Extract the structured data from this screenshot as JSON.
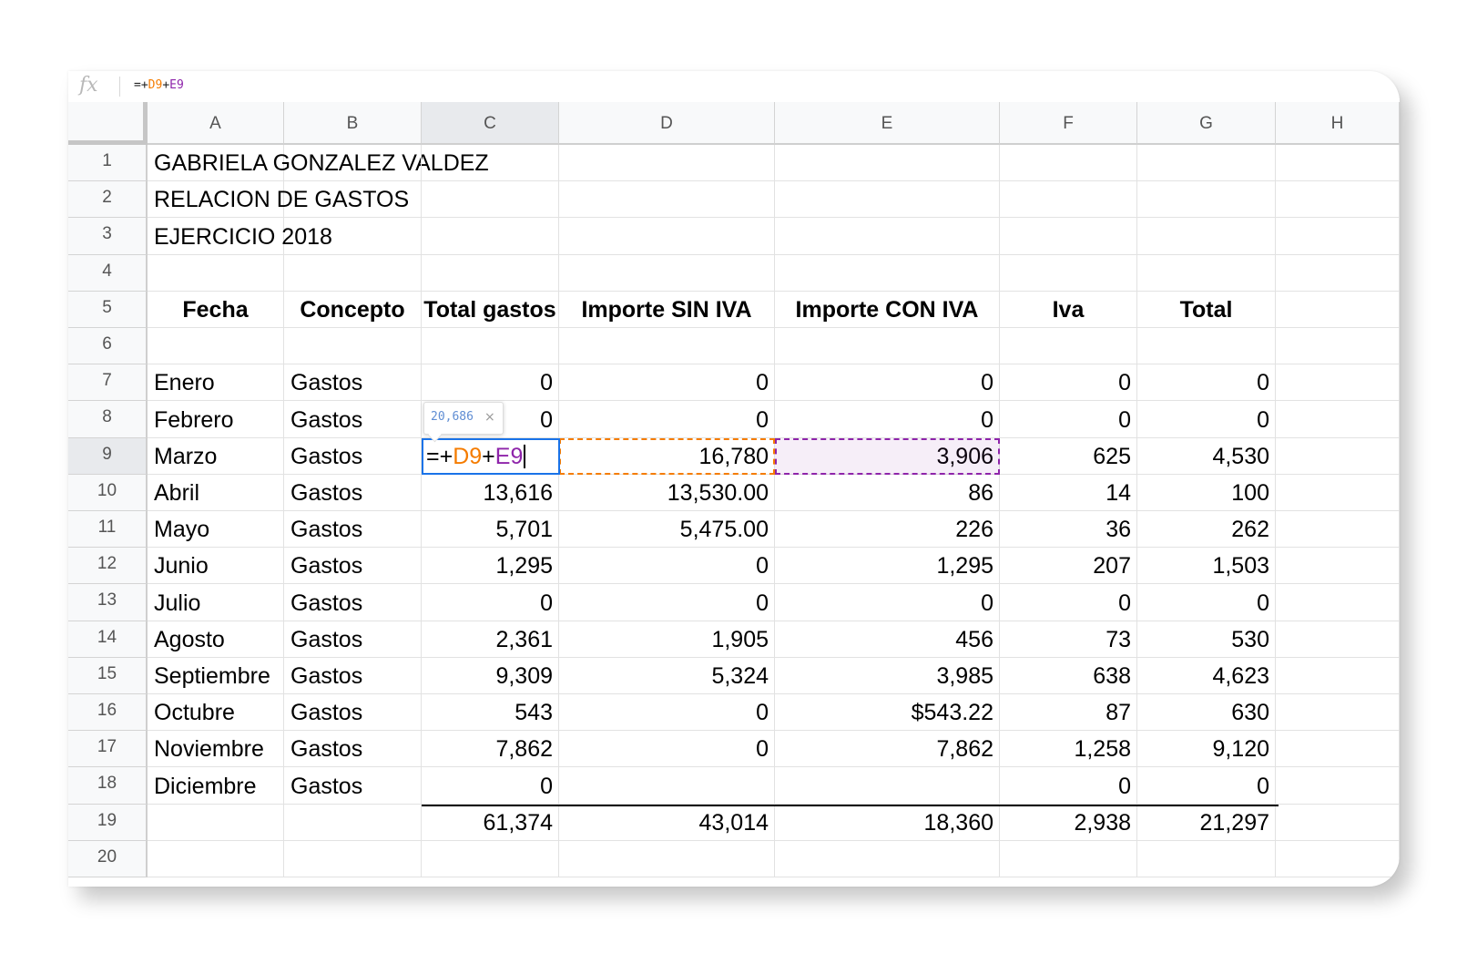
{
  "formula_bar": {
    "fx_label": "fx",
    "prefix": "=+",
    "ref1": "D9",
    "plus": "+",
    "ref2": "E9"
  },
  "columns": [
    "A",
    "B",
    "C",
    "D",
    "E",
    "F",
    "G",
    "H"
  ],
  "active_column": "C",
  "rows": [
    "1",
    "2",
    "3",
    "4",
    "5",
    "6",
    "7",
    "8",
    "9",
    "10",
    "11",
    "12",
    "13",
    "14",
    "15",
    "16",
    "17",
    "18",
    "19",
    "20"
  ],
  "active_row": "9",
  "title_lines": [
    "GABRIELA GONZALEZ VALDEZ",
    "RELACION DE GASTOS",
    "EJERCICIO 2018"
  ],
  "headers": [
    "Fecha",
    "Concepto",
    "Total gastos",
    "Importe SIN IVA",
    "Importe CON IVA",
    "Iva",
    "Total"
  ],
  "data_rows": [
    [
      "Enero",
      "Gastos",
      "0",
      "0",
      "0",
      "0",
      "0"
    ],
    [
      "Febrero",
      "Gastos",
      "0",
      "0",
      "0",
      "0",
      "0"
    ],
    [
      "Marzo",
      "Gastos",
      "",
      "16,780",
      "3,906",
      "625",
      "4,530"
    ],
    [
      "Abril",
      "Gastos",
      "13,616",
      "13,530.00",
      "86",
      "14",
      "100"
    ],
    [
      "Mayo",
      "Gastos",
      "5,701",
      "5,475.00",
      "226",
      "36",
      "262"
    ],
    [
      "Junio",
      "Gastos",
      "1,295",
      "0",
      "1,295",
      "207",
      "1,503"
    ],
    [
      "Julio",
      "Gastos",
      "0",
      "0",
      "0",
      "0",
      "0"
    ],
    [
      "Agosto",
      "Gastos",
      "2,361",
      "1,905",
      "456",
      "73",
      "530"
    ],
    [
      "Septiembre",
      "Gastos",
      "9,309",
      "5,324",
      "3,985",
      "638",
      "4,623"
    ],
    [
      "Octubre",
      "Gastos",
      "543",
      "0",
      "$543.22",
      "87",
      "630"
    ],
    [
      "Noviembre",
      "Gastos",
      "7,862",
      "0",
      "7,862",
      "1,258",
      "9,120"
    ],
    [
      "Diciembre",
      "Gastos",
      "0",
      "",
      "",
      "0",
      "0"
    ]
  ],
  "totals_row": [
    "",
    "",
    "61,374",
    "43,014",
    "18,360",
    "2,938",
    "21,297"
  ],
  "editor": {
    "prefix": "=+",
    "ref1": "D9",
    "plus": "+",
    "ref2": "E9"
  },
  "tooltip": {
    "value": "20,686",
    "close": "×"
  },
  "colors": {
    "selection": "#1a73e8",
    "ref1": "#f57c00",
    "ref2": "#8e24aa"
  }
}
